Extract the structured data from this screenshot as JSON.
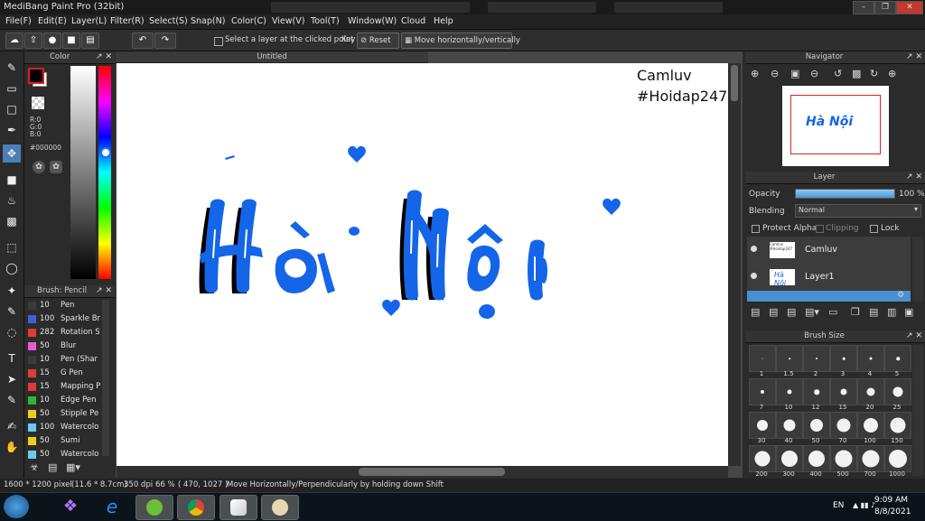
{
  "app": {
    "title": "MediBang Paint Pro (32bit)"
  },
  "menu": [
    "File(F)",
    "Edit(E)",
    "Layer(L)",
    "Filter(R)",
    "Select(S)",
    "Snap(N)",
    "Color(C)",
    "View(V)",
    "Tool(T)",
    "Window(W)",
    "Cloud",
    "Help"
  ],
  "toolbar": {
    "select_layer_label": "Select a layer at the clicked point",
    "key_label": "Key",
    "reset_label": "Reset",
    "move_label": "Move horizontally/vertically"
  },
  "color_panel": {
    "title": "Color",
    "r": "R:0",
    "g": "G:0",
    "b": "B:0",
    "hex": "#000000",
    "foreground": "#000000"
  },
  "brush_panel": {
    "title": "Brush: Pencil",
    "items": [
      {
        "size": "10",
        "name": "Pen",
        "color": "#3b3b3b"
      },
      {
        "size": "100",
        "name": "Sparkle Br",
        "color": "#3f5fd8"
      },
      {
        "size": "282",
        "name": "Rotation S",
        "color": "#e03a3a"
      },
      {
        "size": "50",
        "name": "Blur",
        "color": "#e85bd8"
      },
      {
        "size": "10",
        "name": "Pen (Shar",
        "color": "#3b3b3b"
      },
      {
        "size": "15",
        "name": "G Pen",
        "color": "#e03a3a"
      },
      {
        "size": "15",
        "name": "Mapping P",
        "color": "#e03a3a"
      },
      {
        "size": "10",
        "name": "Edge Pen",
        "color": "#2fb82f"
      },
      {
        "size": "50",
        "name": "Stipple Pe",
        "color": "#e8d020"
      },
      {
        "size": "100",
        "name": "Watercolo",
        "color": "#6fc8ef"
      },
      {
        "size": "50",
        "name": "Sumi",
        "color": "#e8d020"
      },
      {
        "size": "50",
        "name": "Watercolo",
        "color": "#6fc8ef"
      }
    ]
  },
  "canvas": {
    "tab_title": "Untitled",
    "signature_line1": "Camluv",
    "signature_line2": "#Hoidap247",
    "art_text": "Hà Nội",
    "ink_color": "#1565e8"
  },
  "navigator": {
    "title": "Navigator"
  },
  "layer_panel": {
    "title": "Layer",
    "opacity_label": "Opacity",
    "opacity_value": "100 %",
    "opacity": 1.0,
    "blending_label": "Blending",
    "blending_value": "Normal",
    "protect_alpha": "Protect Alpha",
    "clipping": "Clipping",
    "lock": "Lock",
    "layers": [
      {
        "name": "Camluv",
        "thumb": "Camluv #Hoidap247"
      },
      {
        "name": "Layer1",
        "thumb": ""
      }
    ]
  },
  "brush_size_panel": {
    "title": "Brush Size",
    "sizes": [
      "1",
      "1.5",
      "2",
      "3",
      "4",
      "5",
      "7",
      "10",
      "12",
      "15",
      "20",
      "25",
      "30",
      "40",
      "50",
      "70",
      "100",
      "150",
      "200",
      "300",
      "400",
      "500",
      "700",
      "1000"
    ]
  },
  "status": {
    "dimensions": "1600 * 1200 pixel",
    "physical": "(11.6 * 8.7cm)",
    "dpi": "350 dpi",
    "zoom": "66 %",
    "coords": "( 470, 1027 )",
    "hint": "Move Horizontally/Perpendicularly by holding down Shift"
  },
  "taskbar": {
    "lang": "EN",
    "time": "9:09 AM",
    "date": "8/8/2021"
  }
}
